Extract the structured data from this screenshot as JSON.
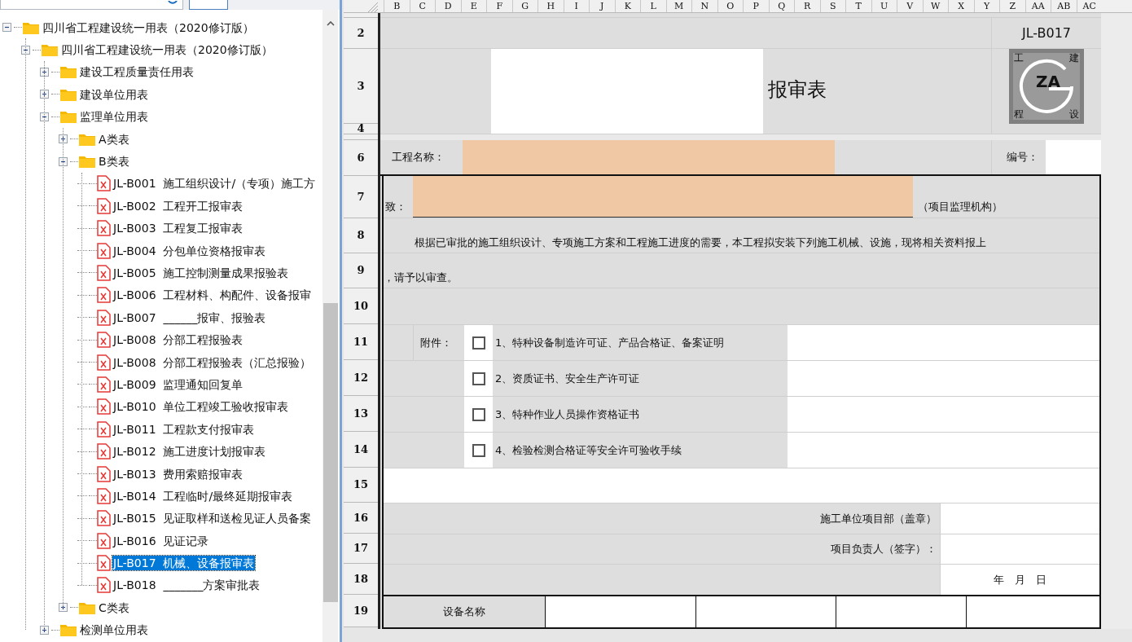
{
  "tree": {
    "label": "四川省工程建设统一用表（2020修订版）",
    "kind": "folder",
    "expanded": true,
    "selected": false,
    "children": [
      {
        "label": "四川省工程建设统一用表（2020修订版）",
        "kind": "folder",
        "expanded": true,
        "selected": false,
        "children": [
          {
            "label": "建设工程质量责任用表",
            "kind": "folder",
            "expanded": false,
            "selected": false
          },
          {
            "label": "建设单位用表",
            "kind": "folder",
            "expanded": false,
            "selected": false
          },
          {
            "label": "监理单位用表",
            "kind": "folder",
            "expanded": true,
            "selected": false,
            "children": [
              {
                "label": "A类表",
                "kind": "folder",
                "expanded": false,
                "selected": false
              },
              {
                "label": "B类表",
                "kind": "folder",
                "expanded": true,
                "selected": false,
                "children": [
                  {
                    "label": "JL-B001  施工组织设计/（专项）施工方",
                    "kind": "file",
                    "selected": false
                  },
                  {
                    "label": "JL-B002  工程开工报审表",
                    "kind": "file",
                    "selected": false
                  },
                  {
                    "label": "JL-B003  工程复工报审表",
                    "kind": "file",
                    "selected": false
                  },
                  {
                    "label": "JL-B004  分包单位资格报审表",
                    "kind": "file",
                    "selected": false
                  },
                  {
                    "label": "JL-B005  施工控制测量成果报验表",
                    "kind": "file",
                    "selected": false
                  },
                  {
                    "label": "JL-B006  工程材料、构配件、设备报审",
                    "kind": "file",
                    "selected": false
                  },
                  {
                    "label": "JL-B007  ______报审、报验表",
                    "kind": "file",
                    "selected": false
                  },
                  {
                    "label": "JL-B008  分部工程报验表",
                    "kind": "file",
                    "selected": false
                  },
                  {
                    "label": "JL-B008  分部工程报验表（汇总报验）",
                    "kind": "file",
                    "selected": false
                  },
                  {
                    "label": "JL-B009  监理通知回复单",
                    "kind": "file",
                    "selected": false
                  },
                  {
                    "label": "JL-B010  单位工程竣工验收报审表",
                    "kind": "file",
                    "selected": false
                  },
                  {
                    "label": "JL-B011  工程款支付报审表",
                    "kind": "file",
                    "selected": false
                  },
                  {
                    "label": "JL-B012  施工进度计划报审表",
                    "kind": "file",
                    "selected": false
                  },
                  {
                    "label": "JL-B013  费用索赔报审表",
                    "kind": "file",
                    "selected": false
                  },
                  {
                    "label": "JL-B014  工程临时/最终延期报审表",
                    "kind": "file",
                    "selected": false
                  },
                  {
                    "label": "JL-B015  见证取样和送检见证人员备案",
                    "kind": "file",
                    "selected": false
                  },
                  {
                    "label": "JL-B016  见证记录",
                    "kind": "file",
                    "selected": false
                  },
                  {
                    "label": "JL-B017  机械、设备报审表",
                    "kind": "file",
                    "selected": true
                  },
                  {
                    "label": "JL-B018  _______方案审批表",
                    "kind": "file",
                    "selected": false
                  }
                ]
              },
              {
                "label": "C类表",
                "kind": "folder",
                "expanded": false,
                "selected": false
              }
            ]
          },
          {
            "label": "检测单位用表",
            "kind": "folder",
            "expanded": false,
            "selected": false
          }
        ]
      }
    ]
  },
  "sheet": {
    "columns": [
      "B",
      "C",
      "D",
      "E",
      "F",
      "G",
      "H",
      "I",
      "J",
      "K",
      "L",
      "M",
      "N",
      "O",
      "P",
      "Q",
      "R",
      "S",
      "T",
      "U",
      "V",
      "W",
      "X",
      "Y",
      "Z",
      "AA",
      "AB",
      "AC"
    ],
    "row_numbers": [
      "2",
      "3",
      "4",
      "6",
      "7",
      "8",
      "9",
      "10",
      "11",
      "12",
      "13",
      "14",
      "15",
      "16",
      "17",
      "18",
      "19"
    ],
    "form": {
      "code": "JL-B017",
      "title": "报审表",
      "logo": {
        "letters": "ZA",
        "corners": [
          "工",
          "建",
          "程",
          "设"
        ]
      },
      "project_label": "工程名称：",
      "number_label": "编号：",
      "to_label": "致：",
      "to_suffix": "（项目监理机构）",
      "body_line_1": "根据已审批的施工组织设计、专项施工方案和工程施工进度的需要，本工程拟安装下列施工机械、设施，现将相关资料报上",
      "body_line_2": "，请予以审查。",
      "attachments_label": "附件：",
      "attachments": [
        {
          "text": "1、特种设备制造许可证、产品合格证、备案证明",
          "checked": false
        },
        {
          "text": "2、资质证书、安全生产许可证",
          "checked": false
        },
        {
          "text": "3、特种作业人员操作资格证书",
          "checked": false
        },
        {
          "text": "4、检验检测合格证等安全许可验收手续",
          "checked": false
        }
      ],
      "sign_lines": [
        "施工单位项目部（盖章）",
        "项目负责人（签字）：",
        "年　月　日"
      ],
      "equipment_label": "设备名称"
    }
  }
}
